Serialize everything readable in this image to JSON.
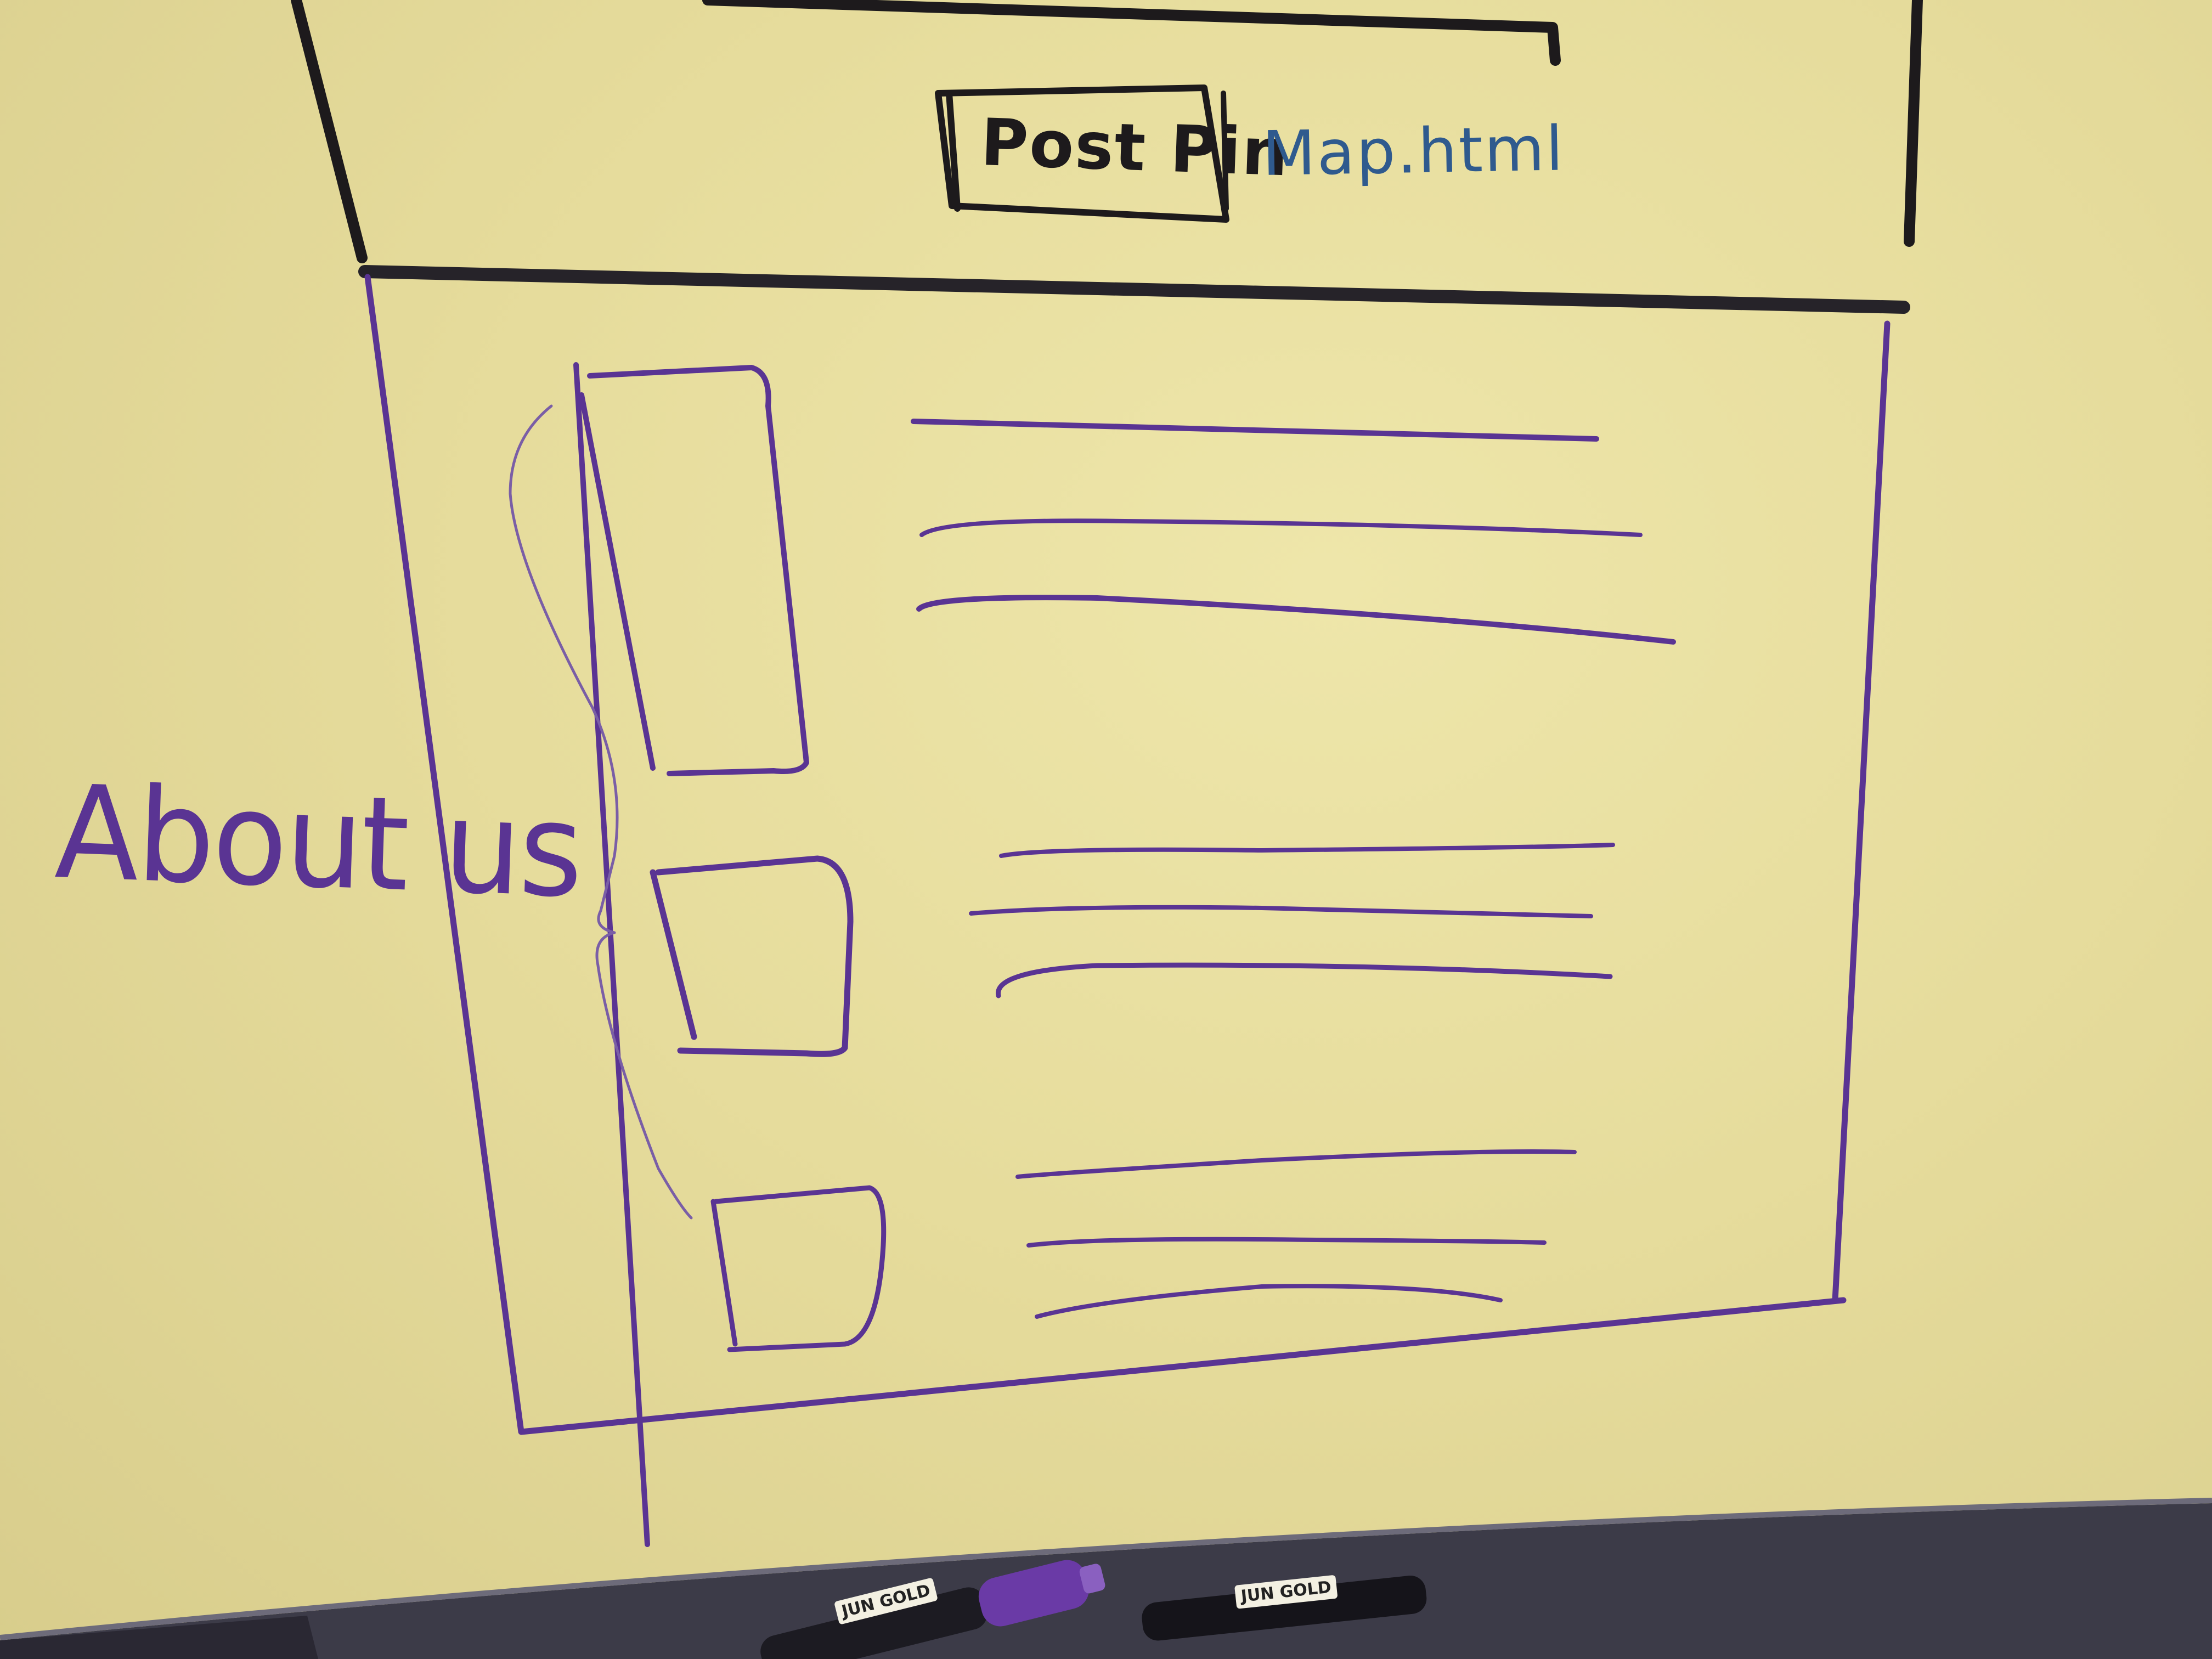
{
  "whiteboard": {
    "header_button_label": "Post Pin",
    "header_link_label": "Map.html",
    "side_annotation": "About us",
    "marker_brand_labels": [
      "JUN GOLD",
      "JUN GOLD"
    ]
  },
  "colors": {
    "board": "#e6dc9c",
    "black_ink": "#1d1a1c",
    "purple_ink": "#5a3493",
    "blue_ink": "#2f5a8e",
    "tray": "#3c3b48"
  }
}
